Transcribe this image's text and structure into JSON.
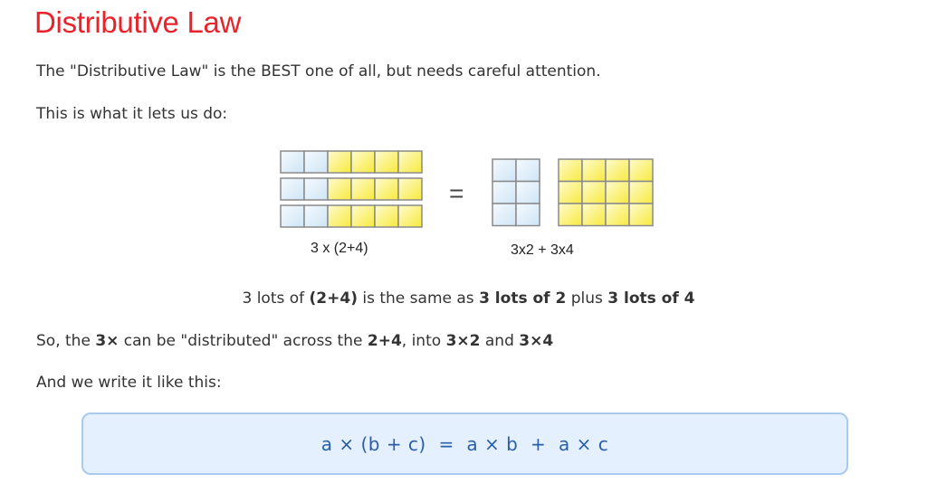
{
  "title": "Distributive Law",
  "intro": "The \"Distributive Law\" is the BEST one of all, but needs careful attention.",
  "lead": "This is what it lets us do:",
  "diagram": {
    "left_caption": "3 x (2+4)",
    "right_caption": "3x2 + 3x4",
    "equals": "=",
    "colors": {
      "blue_cell": "#e4f1fb",
      "yellow_cell": "#fbf27a",
      "border": "#8a8a8a"
    }
  },
  "explanation": {
    "t1": "3 lots of ",
    "b1": "(2+4)",
    "t2": " is the same as ",
    "b2": "3 lots of 2",
    "t3": " plus ",
    "b3": "3 lots of 4"
  },
  "so_line": {
    "t1": "So, the ",
    "b1": "3×",
    "t2": " can be \"distributed\" across the ",
    "b2": "2+4",
    "t3": ", into ",
    "b3": "3×2",
    "t4": " and ",
    "b4": "3×4"
  },
  "write_line": "And we write it like this:",
  "formula": "a × (b + c)  =  a × b  +  a × c"
}
